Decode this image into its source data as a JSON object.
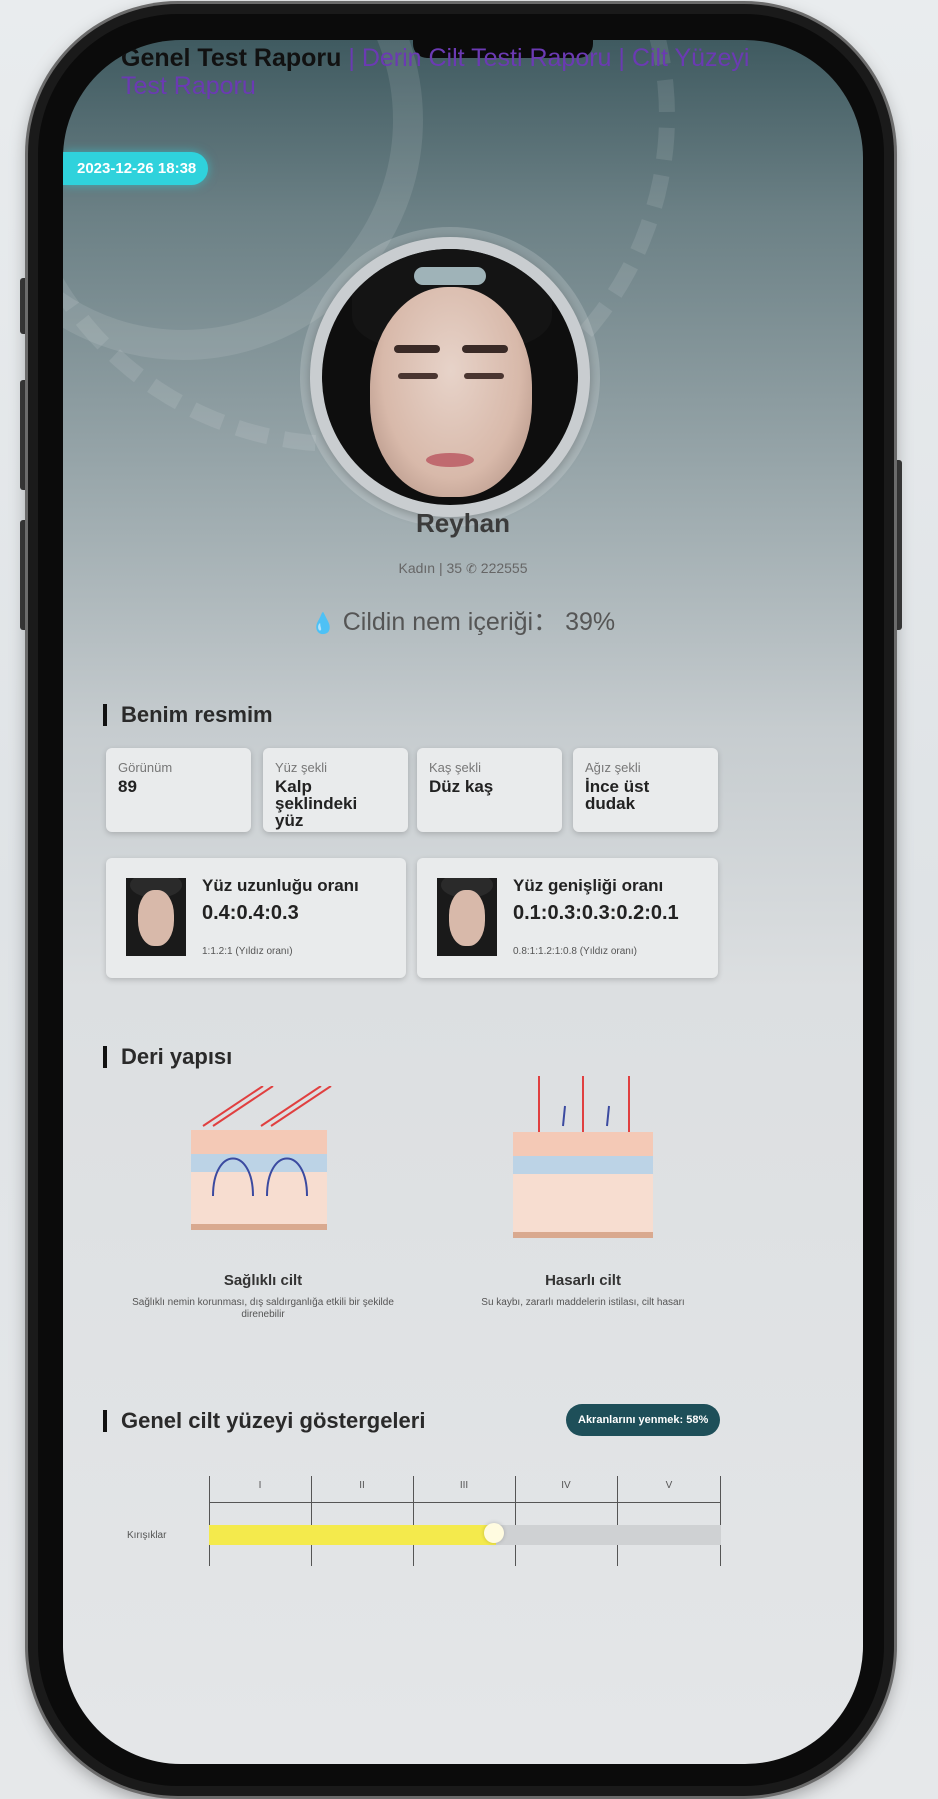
{
  "tabs": {
    "general": "Genel Test Raporu",
    "sep1": " | ",
    "deep": "Derin Cilt Testi Raporu",
    "sep2": " | ",
    "surface": "Cilt Yüzeyi Test Raporu"
  },
  "datetime": "2023-12-26 18:38",
  "profile": {
    "name": "Reyhan",
    "gender": "Kadın",
    "age": "35",
    "phone": "222555",
    "moisture_label": "Cildin nem içeriği",
    "moisture_value": "39%"
  },
  "my_picture": {
    "title": "Benim resmim",
    "cards": [
      {
        "label": "Görünüm",
        "value": "89"
      },
      {
        "label": "Yüz şekli",
        "value": "Kalp şeklindeki yüz"
      },
      {
        "label": "Kaş şekli",
        "value": "Düz kaş"
      },
      {
        "label": "Ağız şekli",
        "value": "İnce üst dudak"
      }
    ],
    "ratios": [
      {
        "title": "Yüz uzunluğu oranı",
        "value": "0.4:0.4:0.3",
        "note": "1:1.2:1 (Yıldız oranı)"
      },
      {
        "title": "Yüz genişliği oranı",
        "value": "0.1:0.3:0.3:0.2:0.1",
        "note": "0.8:1:1.2:1:0.8 (Yıldız oranı)"
      }
    ]
  },
  "skin_structure": {
    "title": "Deri yapısı",
    "healthy": {
      "title": "Sağlıklı cilt",
      "desc": "Sağlıklı nemin korunması, dış saldırganlığa etkili bir şekilde direnebilir"
    },
    "damaged": {
      "title": "Hasarlı cilt",
      "desc": "Su kaybı, zararlı maddelerin istilası, cilt hasarı"
    }
  },
  "indicators": {
    "title": "Genel cilt yüzeyi göstergeleri",
    "peer_label": "Akranlarını yenmek:",
    "peer_value": "58%",
    "levels": [
      "I",
      "II",
      "III",
      "IV",
      "V"
    ],
    "rows": [
      {
        "label": "Kırışıklar",
        "fraction": 0.56
      }
    ]
  },
  "colors": {
    "accent": "#2fd2dc",
    "tab_link": "#6b3ab3",
    "badge": "#1e4f59",
    "bar": "#f4ea4c"
  }
}
